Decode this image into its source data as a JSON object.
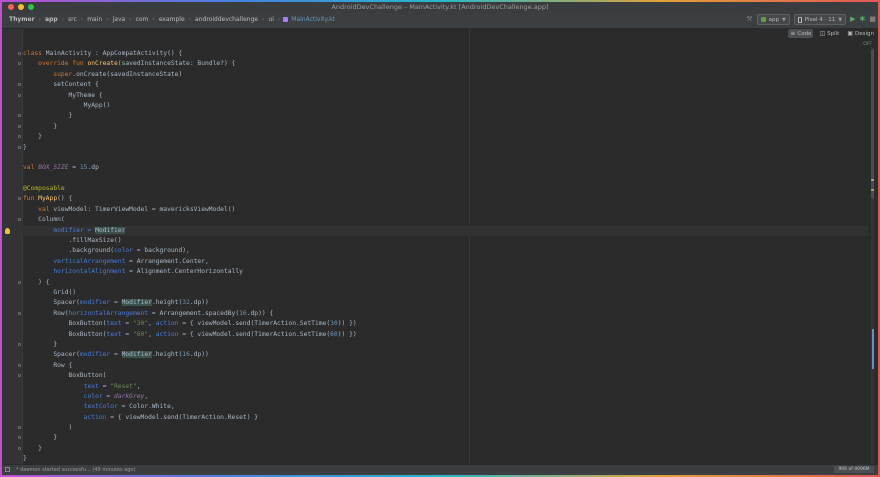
{
  "window": {
    "title": "AndroidDevChallenge – MainActivity.kt [AndroidDevChallenge.app]"
  },
  "breadcrumbs": [
    "Thymer",
    "app",
    "src",
    "main",
    "java",
    "com",
    "example",
    "androiddevchallenge",
    "ui",
    "MainActivity.kt"
  ],
  "toolbar": {
    "run_config": "app",
    "device": "Pixel 4 - 11",
    "icons": [
      "run-icon",
      "debug-icon",
      "stop-icon"
    ]
  },
  "view_modes": {
    "code": "Code",
    "split": "Split",
    "design": "Design"
  },
  "editor": {
    "highlighting": "OFF",
    "lines": [
      [
        {
          "t": "class ",
          "c": "kw"
        },
        {
          "t": "MainActivity : AppCompatActivity() {",
          "c": "pl"
        }
      ],
      [
        {
          "t": "    override fun ",
          "c": "kw"
        },
        {
          "t": "onCreate",
          "c": "fn"
        },
        {
          "t": "(savedInstanceState: Bundle?) {",
          "c": "pl"
        }
      ],
      [
        {
          "t": "        ",
          "c": "pl"
        },
        {
          "t": "super",
          "c": "kw"
        },
        {
          "t": ".onCreate(savedInstanceState)",
          "c": "pl"
        }
      ],
      [
        {
          "t": "        setContent {",
          "c": "pl"
        }
      ],
      [
        {
          "t": "            MyTheme {",
          "c": "pl"
        }
      ],
      [
        {
          "t": "                MyApp()",
          "c": "pl"
        }
      ],
      [
        {
          "t": "            }",
          "c": "pl"
        }
      ],
      [
        {
          "t": "        }",
          "c": "pl"
        }
      ],
      [
        {
          "t": "    }",
          "c": "pl"
        }
      ],
      [
        {
          "t": "}",
          "c": "pl"
        }
      ],
      [],
      [
        {
          "t": "val ",
          "c": "kw"
        },
        {
          "t": "BOX_SIZE",
          "c": "ital"
        },
        {
          "t": " = ",
          "c": "pl"
        },
        {
          "t": "15",
          "c": "num"
        },
        {
          "t": ".dp",
          "c": "pl"
        }
      ],
      [],
      [
        {
          "t": "@Composable",
          "c": "anno"
        }
      ],
      [
        {
          "t": "fun ",
          "c": "kw"
        },
        {
          "t": "MyApp",
          "c": "fn"
        },
        {
          "t": "() {",
          "c": "pl"
        }
      ],
      [
        {
          "t": "    ",
          "c": "pl"
        },
        {
          "t": "val ",
          "c": "kw"
        },
        {
          "t": "viewModel: TimerViewModel = mavericksViewModel()",
          "c": "pl"
        }
      ],
      [
        {
          "t": "    Column(",
          "c": "pl"
        }
      ],
      [
        {
          "t": "        ",
          "c": "pl"
        },
        {
          "t": "modifier",
          "c": "param"
        },
        {
          "t": " = ",
          "c": "param"
        },
        {
          "t": "Modifier",
          "c": "hl"
        }
      ],
      [
        {
          "t": "            .fillMaxSize()",
          "c": "pl"
        }
      ],
      [
        {
          "t": "            .background(",
          "c": "pl"
        },
        {
          "t": "color",
          "c": "param"
        },
        {
          "t": " = background),",
          "c": "pl"
        }
      ],
      [
        {
          "t": "        ",
          "c": "pl"
        },
        {
          "t": "verticalArrangement",
          "c": "param"
        },
        {
          "t": " = Arrangement.Center,",
          "c": "pl"
        }
      ],
      [
        {
          "t": "        ",
          "c": "pl"
        },
        {
          "t": "horizontalAlignment",
          "c": "param"
        },
        {
          "t": " = Alignment.CenterHorizontally",
          "c": "pl"
        }
      ],
      [
        {
          "t": "    ) {",
          "c": "pl"
        }
      ],
      [
        {
          "t": "        Grid()",
          "c": "pl"
        }
      ],
      [
        {
          "t": "        Spacer(",
          "c": "pl"
        },
        {
          "t": "modifier",
          "c": "param"
        },
        {
          "t": " = ",
          "c": "pl"
        },
        {
          "t": "Modifier",
          "c": "hl"
        },
        {
          "t": ".height(",
          "c": "pl"
        },
        {
          "t": "32",
          "c": "num"
        },
        {
          "t": ".dp))",
          "c": "pl"
        }
      ],
      [
        {
          "t": "        Row(",
          "c": "pl"
        },
        {
          "t": "horizontalArrangement",
          "c": "param"
        },
        {
          "t": " = Arrangement.spacedBy(",
          "c": "pl"
        },
        {
          "t": "16",
          "c": "num"
        },
        {
          "t": ".dp)) {",
          "c": "pl"
        }
      ],
      [
        {
          "t": "            BoxButton(",
          "c": "pl"
        },
        {
          "t": "text",
          "c": "param"
        },
        {
          "t": " = ",
          "c": "pl"
        },
        {
          "t": "\"30\"",
          "c": "str"
        },
        {
          "t": ", ",
          "c": "pl"
        },
        {
          "t": "action",
          "c": "param"
        },
        {
          "t": " = { viewModel.send(TimerAction.SetTime(",
          "c": "pl"
        },
        {
          "t": "30",
          "c": "num"
        },
        {
          "t": ")) })",
          "c": "pl"
        }
      ],
      [
        {
          "t": "            BoxButton(",
          "c": "pl"
        },
        {
          "t": "text",
          "c": "param"
        },
        {
          "t": " = ",
          "c": "pl"
        },
        {
          "t": "\"60\"",
          "c": "str"
        },
        {
          "t": ", ",
          "c": "pl"
        },
        {
          "t": "action",
          "c": "param"
        },
        {
          "t": " = { viewModel.send(TimerAction.SetTime(",
          "c": "pl"
        },
        {
          "t": "60",
          "c": "num"
        },
        {
          "t": ")) })",
          "c": "pl"
        }
      ],
      [
        {
          "t": "        }",
          "c": "pl"
        }
      ],
      [
        {
          "t": "        Spacer(",
          "c": "pl"
        },
        {
          "t": "modifier",
          "c": "param"
        },
        {
          "t": " = ",
          "c": "pl"
        },
        {
          "t": "Modifier",
          "c": "hl"
        },
        {
          "t": ".height(",
          "c": "pl"
        },
        {
          "t": "16",
          "c": "num"
        },
        {
          "t": ".dp))",
          "c": "pl"
        }
      ],
      [
        {
          "t": "        Row {",
          "c": "pl"
        }
      ],
      [
        {
          "t": "            BoxButton(",
          "c": "pl"
        }
      ],
      [
        {
          "t": "                ",
          "c": "pl"
        },
        {
          "t": "text",
          "c": "param"
        },
        {
          "t": " = ",
          "c": "pl"
        },
        {
          "t": "\"Reset\"",
          "c": "str"
        },
        {
          "t": ",",
          "c": "pl"
        }
      ],
      [
        {
          "t": "                ",
          "c": "pl"
        },
        {
          "t": "color",
          "c": "param"
        },
        {
          "t": " = ",
          "c": "pl"
        },
        {
          "t": "darkGrey",
          "c": "ital"
        },
        {
          "t": ",",
          "c": "pl"
        }
      ],
      [
        {
          "t": "                ",
          "c": "pl"
        },
        {
          "t": "textColor",
          "c": "param"
        },
        {
          "t": " = Color.White,",
          "c": "pl"
        }
      ],
      [
        {
          "t": "                ",
          "c": "pl"
        },
        {
          "t": "action",
          "c": "param"
        },
        {
          "t": " = { viewModel.send(TimerAction.Reset) }",
          "c": "pl"
        }
      ],
      [
        {
          "t": "            )",
          "c": "pl"
        }
      ],
      [
        {
          "t": "        }",
          "c": "pl"
        }
      ],
      [
        {
          "t": "    }",
          "c": "pl"
        }
      ],
      [
        {
          "t": "}",
          "c": "pl"
        }
      ]
    ]
  },
  "status": {
    "message": "* daemon started successfu... (49 minutes ago)",
    "memory": "966 of 4096M"
  },
  "colors": {
    "keyword": "#cc7832",
    "function": "#ffc66d",
    "number": "#6897bb",
    "string": "#6a8759",
    "named_param": "#467cda",
    "annotation": "#bbb529",
    "editor_bg": "#2b2b2b"
  }
}
